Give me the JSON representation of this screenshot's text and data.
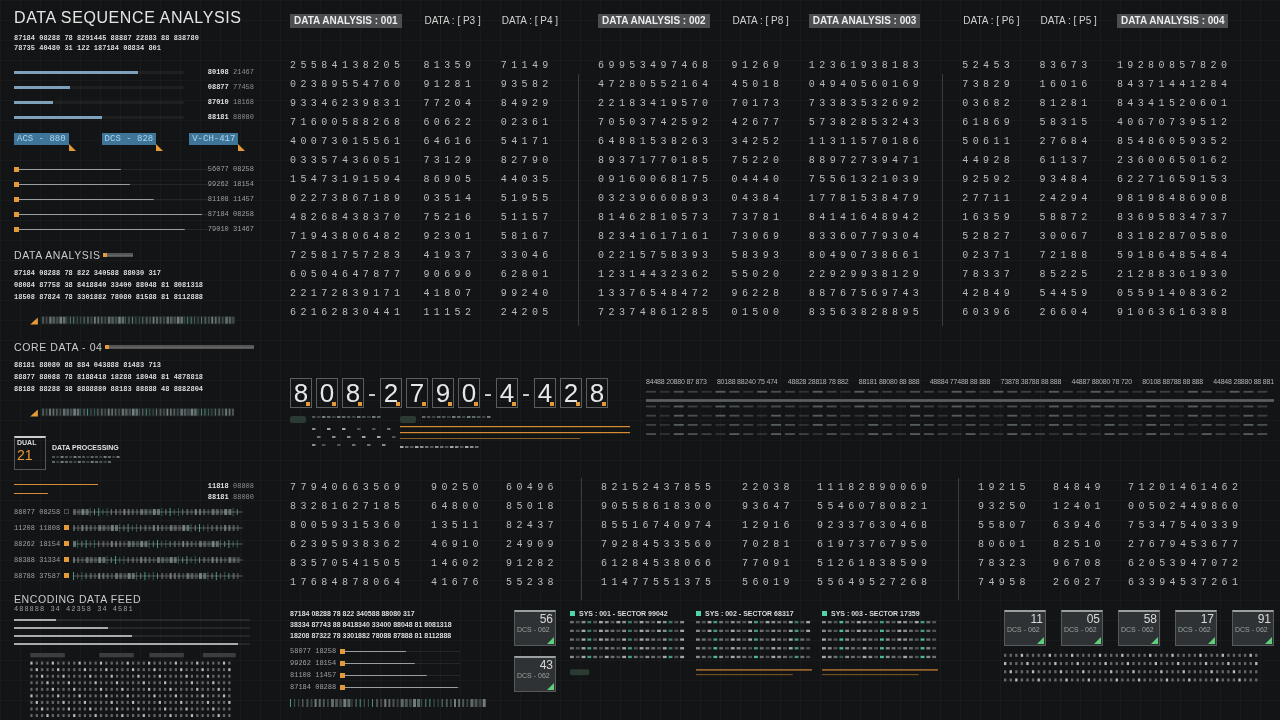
{
  "sidebar": {
    "title": "DATA SEQUENCE ANALYSIS",
    "header_codes": [
      "87184 08288 78 8291445 88887 22883 88 838780",
      "78735 40480 31 122 187184 08834 801"
    ],
    "bars": [
      {
        "level": 0.73,
        "code": "80108",
        "value": "21467"
      },
      {
        "level": 0.33,
        "code": "08877",
        "value": "77458"
      },
      {
        "level": 0.23,
        "code": "87010",
        "value": "18168"
      },
      {
        "level": 0.52,
        "code": "88181",
        "value": "88080"
      }
    ],
    "tags": [
      {
        "label": "ACS - 880"
      },
      {
        "label": "DCS - 828"
      },
      {
        "label": "V-CH-417"
      }
    ],
    "sliders": [
      {
        "level": 0.55,
        "reading": "56077 08258"
      },
      {
        "level": 0.6,
        "reading": "99262 18154"
      },
      {
        "level": 0.72,
        "reading": "81108 11457"
      },
      {
        "level": 0.97,
        "reading": "87184 08258"
      },
      {
        "level": 0.88,
        "reading": "79010 31467"
      }
    ],
    "analysis": {
      "title": "DATA ANALYSIS",
      "codes": [
        "87184 08288 78 822 340588 88030 317",
        "08084 87758 38 8418840 33400 88048 81 8081318",
        "18508 87824 78 3301882 78080 81588 81 8112888"
      ]
    },
    "core": {
      "title": "CORE DATA - 04",
      "codes": [
        "88181 88080 88 884 043888 81483 713",
        "88877 88088 78 8188418 18288 18048 81 4878818",
        "88188 88288 38 8888880 88183 88888 48 8882804"
      ]
    },
    "processing": {
      "badge_label": "DUAL",
      "badge_number": "21",
      "title": "DATA PROCESSING"
    },
    "readings": [
      {
        "code": "11818",
        "value": "08808"
      },
      {
        "code": "88181",
        "value": "88080"
      }
    ],
    "feeds": [
      {
        "reading": "88077 08258",
        "marker": false
      },
      {
        "reading": "11208 11808",
        "marker": true
      },
      {
        "reading": "88262 18154",
        "marker": true
      },
      {
        "reading": "88388 31334",
        "marker": true
      },
      {
        "reading": "88788 37587",
        "marker": true
      }
    ],
    "encoding": {
      "title": "ENCODING DATA FEED",
      "code": "488888 34 42358 34 4581",
      "lines": [
        {
          "level": 0.18
        },
        {
          "level": 0.4
        },
        {
          "level": 0.5
        },
        {
          "level": 0.95
        }
      ]
    }
  },
  "top_grid": {
    "groups": [
      {
        "blocks": [
          {
            "header": {
              "label": "DATA ANALYSIS : 001",
              "kind": "chip"
            },
            "rows": [
              "25584138205",
              "02389554760",
              "93346239831",
              "71600588268",
              "40073015561",
              "03357436051",
              "15473191594",
              "02273867189",
              "48268438370",
              "71943806482",
              "72581757283",
              "60504647877",
              "22172839171",
              "62162830441"
            ]
          },
          {
            "header": {
              "label": "DATA : [ P3 ]",
              "kind": "plain"
            },
            "rows": [
              "81359",
              "91281",
              "77204",
              "60622",
              "64616",
              "73129",
              "86905",
              "03514",
              "75216",
              "92301",
              "41937",
              "90690",
              "41807",
              "11152"
            ]
          },
          {
            "header": {
              "label": "DATA : [ P4 ]",
              "kind": "plain"
            },
            "rows": [
              "71149",
              "93582",
              "84929",
              "02361",
              "54171",
              "82790",
              "44035",
              "51955",
              "51157",
              "58167",
              "33046",
              "62801",
              "99240",
              "24205"
            ]
          }
        ]
      },
      {
        "blocks": [
          {
            "header": {
              "label": "DATA ANALYSIS : 002",
              "kind": "chip"
            },
            "rows": [
              "69953497468",
              "47280552164",
              "22183419570",
              "70503742592",
              "64881538263",
              "89371770185",
              "09160068175",
              "03239660893",
              "81462810573",
              "82341617161",
              "02215758393",
              "12314432362",
              "13376548472",
              "72374861285"
            ]
          },
          {
            "header": {
              "label": "DATA : [ P8 ]",
              "kind": "plain"
            },
            "rows": [
              "91269",
              "45018",
              "70173",
              "42677",
              "34252",
              "75220",
              "04440",
              "04384",
              "73781",
              "73069",
              "58393",
              "55020",
              "96228",
              "01500"
            ]
          },
          {
            "header": {
              "label": "DATA ANALYSIS : 003",
              "kind": "chip"
            },
            "rows": [
              "12361938183",
              "04940560169",
              "73383532692",
              "57382853243",
              "11311570186",
              "88972739471",
              "75561321039",
              "17781538479",
              "84141648942",
              "83360779304",
              "80490738661",
              "22929938129",
              "88767569743",
              "83563828895"
            ]
          }
        ]
      },
      {
        "blocks": [
          {
            "header": {
              "label": "DATA : [ P6 ]",
              "kind": "plain"
            },
            "rows": [
              "52453",
              "73829",
              "03682",
              "61869",
              "50611",
              "44928",
              "92592",
              "27711",
              "16359",
              "52827",
              "02371",
              "78337",
              "42849",
              "60396"
            ]
          },
          {
            "header": {
              "label": "DATA : [ P5 ]",
              "kind": "plain"
            },
            "rows": [
              "83673",
              "16016",
              "81281",
              "58315",
              "27684",
              "61137",
              "93484",
              "24294",
              "58872",
              "30067",
              "72188",
              "85225",
              "54459",
              "26604"
            ]
          },
          {
            "header": {
              "label": "DATA ANALYSIS : 004",
              "kind": "chip"
            },
            "rows": [
              "19280857820",
              "84371441284",
              "84341520601",
              "40670739512",
              "85486059352",
              "23600650162",
              "62271659153",
              "98198486908",
              "83695834737",
              "83182870580",
              "59186485484",
              "21288361930",
              "05591408362",
              "91063616388"
            ]
          }
        ]
      }
    ]
  },
  "middle": {
    "serial": [
      {
        "char": "8",
        "kind": "digit"
      },
      {
        "char": "0",
        "kind": "digit"
      },
      {
        "char": "8",
        "kind": "digit"
      },
      {
        "char": "-",
        "kind": "dash"
      },
      {
        "char": "2",
        "kind": "digit"
      },
      {
        "char": "7",
        "kind": "digit"
      },
      {
        "char": "9",
        "kind": "digit"
      },
      {
        "char": "0",
        "kind": "digit"
      },
      {
        "char": "-",
        "kind": "dash"
      },
      {
        "char": "4",
        "kind": "digit"
      },
      {
        "char": "-",
        "kind": "dash"
      },
      {
        "char": "4",
        "kind": "digit"
      },
      {
        "char": "2",
        "kind": "digit"
      },
      {
        "char": "8",
        "kind": "digit"
      }
    ],
    "table_headers": [
      "84488 20880 87 873",
      "80188 88240 75 474",
      "48828 28818 78 882",
      "88181 88080 88 888",
      "48884 77488 88 888",
      "73878 38788 88 888",
      "44887 88080 78 720",
      "80108 88788 88 888",
      "44848 28880 88 881"
    ]
  },
  "bottom_grid": {
    "groups": [
      {
        "blocks": [
          {
            "rows": [
              "77940663569",
              "83281627185",
              "80059315360",
              "62395938362",
              "83570541505",
              "17684878064"
            ]
          },
          {
            "rows": [
              "90250",
              "64800",
              "13511",
              "46910",
              "14602",
              "41676"
            ]
          },
          {
            "rows": [
              "60496",
              "85018",
              "82437",
              "24909",
              "91282",
              "55238"
            ]
          }
        ]
      },
      {
        "blocks": [
          {
            "rows": [
              "82152437855",
              "90558618300",
              "85516740974",
              "79284533560",
              "61284538066",
              "11477551375"
            ]
          },
          {
            "rows": [
              "22038",
              "93647",
              "12916",
              "70281",
              "77091",
              "56019"
            ]
          },
          {
            "rows": [
              "11182890069",
              "55460780821",
              "92337630468",
              "61973767950",
              "51261838599",
              "55649527268"
            ]
          }
        ]
      },
      {
        "blocks": [
          {
            "rows": [
              "19215",
              "93250",
              "55807",
              "80601",
              "78323",
              "74958"
            ]
          },
          {
            "rows": [
              "84849",
              "12401",
              "63946",
              "82510",
              "96708",
              "26027"
            ]
          },
          {
            "rows": [
              "71201461462",
              "00502449860",
              "75347540339",
              "27679453677",
              "62053947072",
              "63394537261"
            ]
          }
        ]
      }
    ]
  },
  "bottom": {
    "codes": [
      "87184 08288 78 822 340588 88080 317",
      "38334 87743 88 8418340 33400 88048 81 8081318",
      "18208 87322 78 3301882 78088 87888 81 8112888"
    ],
    "sliders": [
      {
        "level": 0.55,
        "reading": "58077 18258"
      },
      {
        "level": 0.62,
        "reading": "99262 18154"
      },
      {
        "level": 0.72,
        "reading": "81108 11457"
      },
      {
        "level": 0.98,
        "reading": "87184 08288"
      }
    ],
    "cards": [
      {
        "number": "56",
        "label": "DCS - 062"
      },
      {
        "number": "43",
        "label": "DCS - 062"
      }
    ],
    "sectors": [
      {
        "title": "SYS : 001 - SECTOR 99042"
      },
      {
        "title": "SYS : 002 - SECTOR 68317"
      },
      {
        "title": "SYS : 003 - SECTOR 17359"
      }
    ],
    "right_cards": [
      {
        "number": "11",
        "label": "DCS - 062"
      },
      {
        "number": "05",
        "label": "DCS - 062"
      },
      {
        "number": "58",
        "label": "DCS - 062"
      },
      {
        "number": "17",
        "label": "DCS - 062"
      },
      {
        "number": "91",
        "label": "DCS - 062"
      }
    ]
  }
}
